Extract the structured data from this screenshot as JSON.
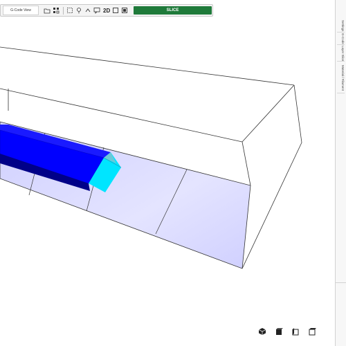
{
  "toolbar": {
    "view_selector": "G-Code View",
    "slice_label": "SLICE",
    "mode_2d": "2D",
    "icons": [
      "open-folder-icon",
      "grid-icon",
      "select-icon",
      "pin-icon",
      "caret-icon",
      "comment-icon",
      "2d-label",
      "square-icon",
      "box-icon"
    ]
  },
  "right_panel": {
    "tabs": [
      "Settings",
      "G-Code Editor",
      "Layer Slice",
      "Material / Filament"
    ]
  },
  "view_buttons": {
    "icons": [
      "iso-view-icon",
      "front-view-icon",
      "side-view-icon",
      "top-view-icon"
    ]
  },
  "colors": {
    "slice_button": "#1f7a3a",
    "part_main": "#0000ff",
    "part_cap": "#00e5ff",
    "bed": "#d5d5ff"
  }
}
